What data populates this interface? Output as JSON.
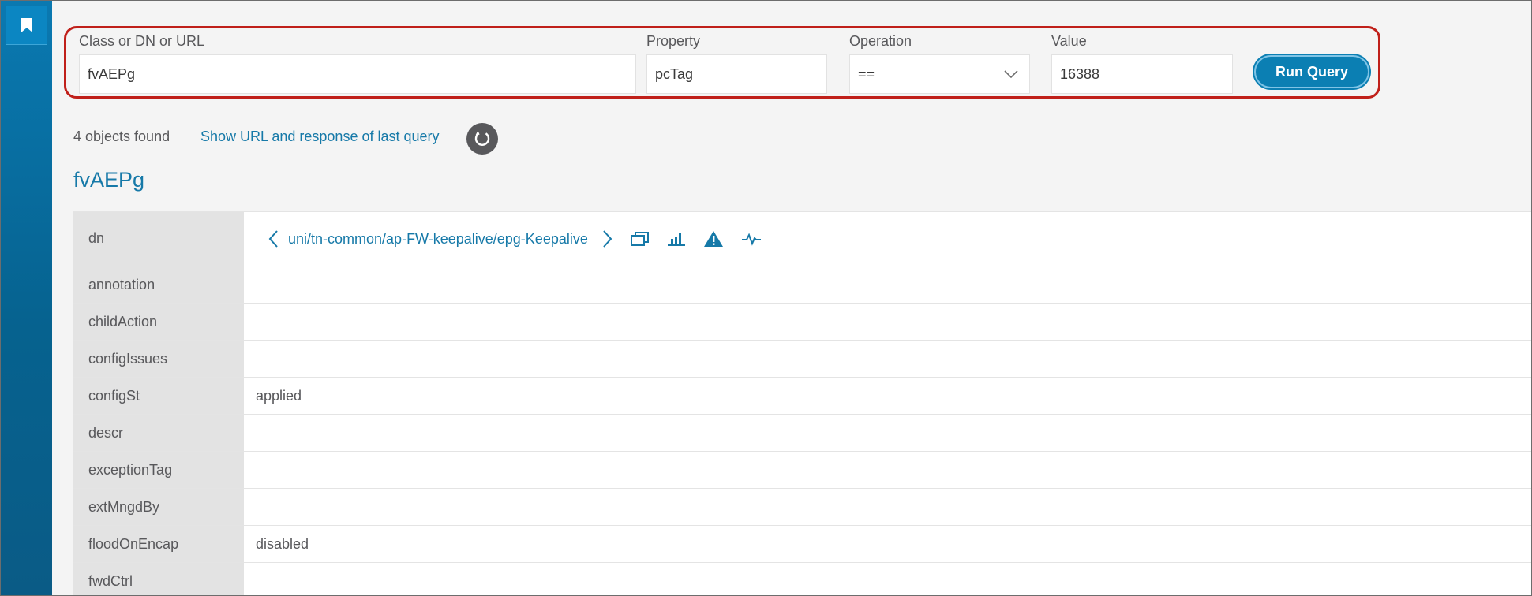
{
  "query": {
    "class_label": "Class or DN or URL",
    "class_value": "fvAEPg",
    "property_label": "Property",
    "property_value": "pcTag",
    "operation_label": "Operation",
    "operation_value": "==",
    "value_label": "Value",
    "value_value": "16388",
    "run_label": "Run Query"
  },
  "results": {
    "count_text": "4 objects found",
    "show_url_text": "Show URL and response of last query",
    "class_title": "fvAEPg"
  },
  "object": {
    "dn_key": "dn",
    "dn_value": "uni/tn-common/ap-FW-keepalive/epg-Keepalive",
    "properties": [
      {
        "key": "annotation",
        "value": ""
      },
      {
        "key": "childAction",
        "value": ""
      },
      {
        "key": "configIssues",
        "value": ""
      },
      {
        "key": "configSt",
        "value": "applied"
      },
      {
        "key": "descr",
        "value": ""
      },
      {
        "key": "exceptionTag",
        "value": ""
      },
      {
        "key": "extMngdBy",
        "value": ""
      },
      {
        "key": "floodOnEncap",
        "value": "disabled"
      },
      {
        "key": "fwdCtrl",
        "value": ""
      }
    ]
  },
  "icons": {
    "sidebar": "bookmark-icon",
    "refresh": "refresh-icon",
    "prev": "chevron-left-icon",
    "next": "chevron-right-icon",
    "window": "open-window-icon",
    "stats": "bar-chart-icon",
    "faults": "warning-icon",
    "health": "health-pulse-icon"
  },
  "colors": {
    "accent": "#1679a8",
    "button": "#0b7fb3",
    "highlight": "#c0201a",
    "sidebar": "#06628f"
  }
}
